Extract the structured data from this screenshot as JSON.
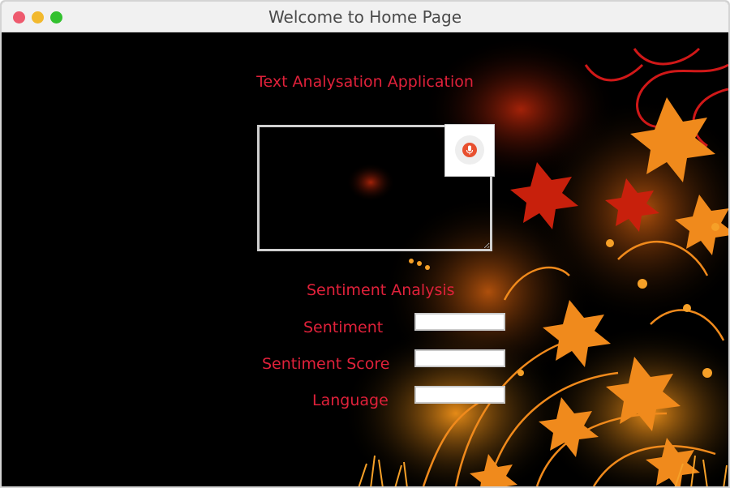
{
  "window": {
    "title": "Welcome to Home Page",
    "controls": {
      "close_color": "#ee5a6e",
      "minimize_color": "#f2b92e",
      "maximize_color": "#33c12f"
    }
  },
  "main": {
    "app_title": "Text Analysation Application",
    "text_input": {
      "value": "",
      "placeholder": ""
    },
    "mic_button": {
      "icon": "microphone-icon",
      "accent": "#e8502f"
    },
    "section_title": "Sentiment Analysis",
    "fields": {
      "sentiment": {
        "label": "Sentiment",
        "value": ""
      },
      "score": {
        "label": "Sentiment Score",
        "value": ""
      },
      "language": {
        "label": "Language",
        "value": ""
      }
    }
  },
  "colors": {
    "label_red": "#e0213a",
    "background": "#000000",
    "art_orange": "#f0781e"
  }
}
